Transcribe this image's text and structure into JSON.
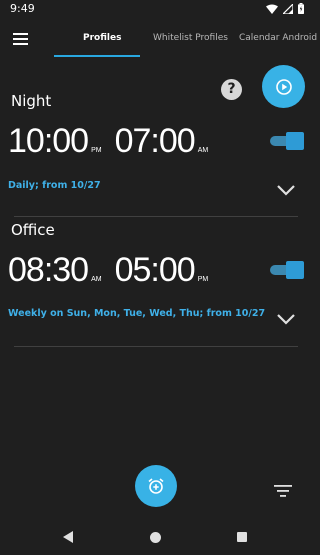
{
  "status_bar": {
    "time": "9:49"
  },
  "tabs": [
    {
      "label": "Profiles",
      "active": true
    },
    {
      "label": "Whitelist Profiles",
      "active": false
    },
    {
      "label": "Calendar Android",
      "active": false
    }
  ],
  "help_label": "?",
  "profiles": [
    {
      "name": "Night",
      "start_time": "10:00",
      "start_ampm": "PM",
      "end_time": "07:00",
      "end_ampm": "AM",
      "schedule": "Daily; from 10/27",
      "enabled": true
    },
    {
      "name": "Office",
      "start_time": "08:30",
      "start_ampm": "AM",
      "end_time": "05:00",
      "end_ampm": "PM",
      "schedule": "Weekly on Sun, Mon, Tue, Wed, Thu; from 10/27",
      "enabled": true
    }
  ],
  "colors": {
    "accent": "#38b2e6",
    "background": "#1f1f1f",
    "schedule_text": "#3fb0e8"
  },
  "icons": [
    "menu-icon",
    "help-icon",
    "play-icon",
    "chevron-down-icon",
    "add-alarm-icon",
    "filter-icon",
    "back-icon",
    "home-icon",
    "recents-icon"
  ]
}
